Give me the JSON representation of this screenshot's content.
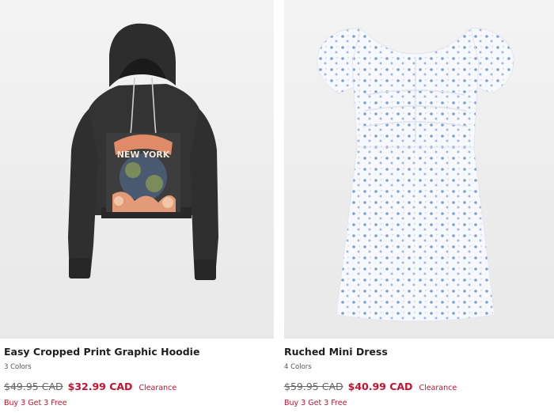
{
  "products": [
    {
      "name": "Easy Cropped Print Graphic Hoodie",
      "colors": "3 Colors",
      "original_price": "$49.95 CAD",
      "sale_price": "$32.99 CAD",
      "badge": "Clearance",
      "promo": "Buy 3 Get 3 Free",
      "image_icon": "hoodie-image",
      "graphic_text": "NEW YORK"
    },
    {
      "name": "Ruched Mini Dress",
      "colors": "4 Colors",
      "original_price": "$59.95 CAD",
      "sale_price": "$40.99 CAD",
      "badge": "Clearance",
      "promo": "Buy 3 Get 3 Free",
      "image_icon": "dress-image"
    }
  ],
  "colors": {
    "sale": "#c8102e",
    "text": "#1f1f1f",
    "muted": "#666666",
    "image_bg": "#ececec"
  }
}
